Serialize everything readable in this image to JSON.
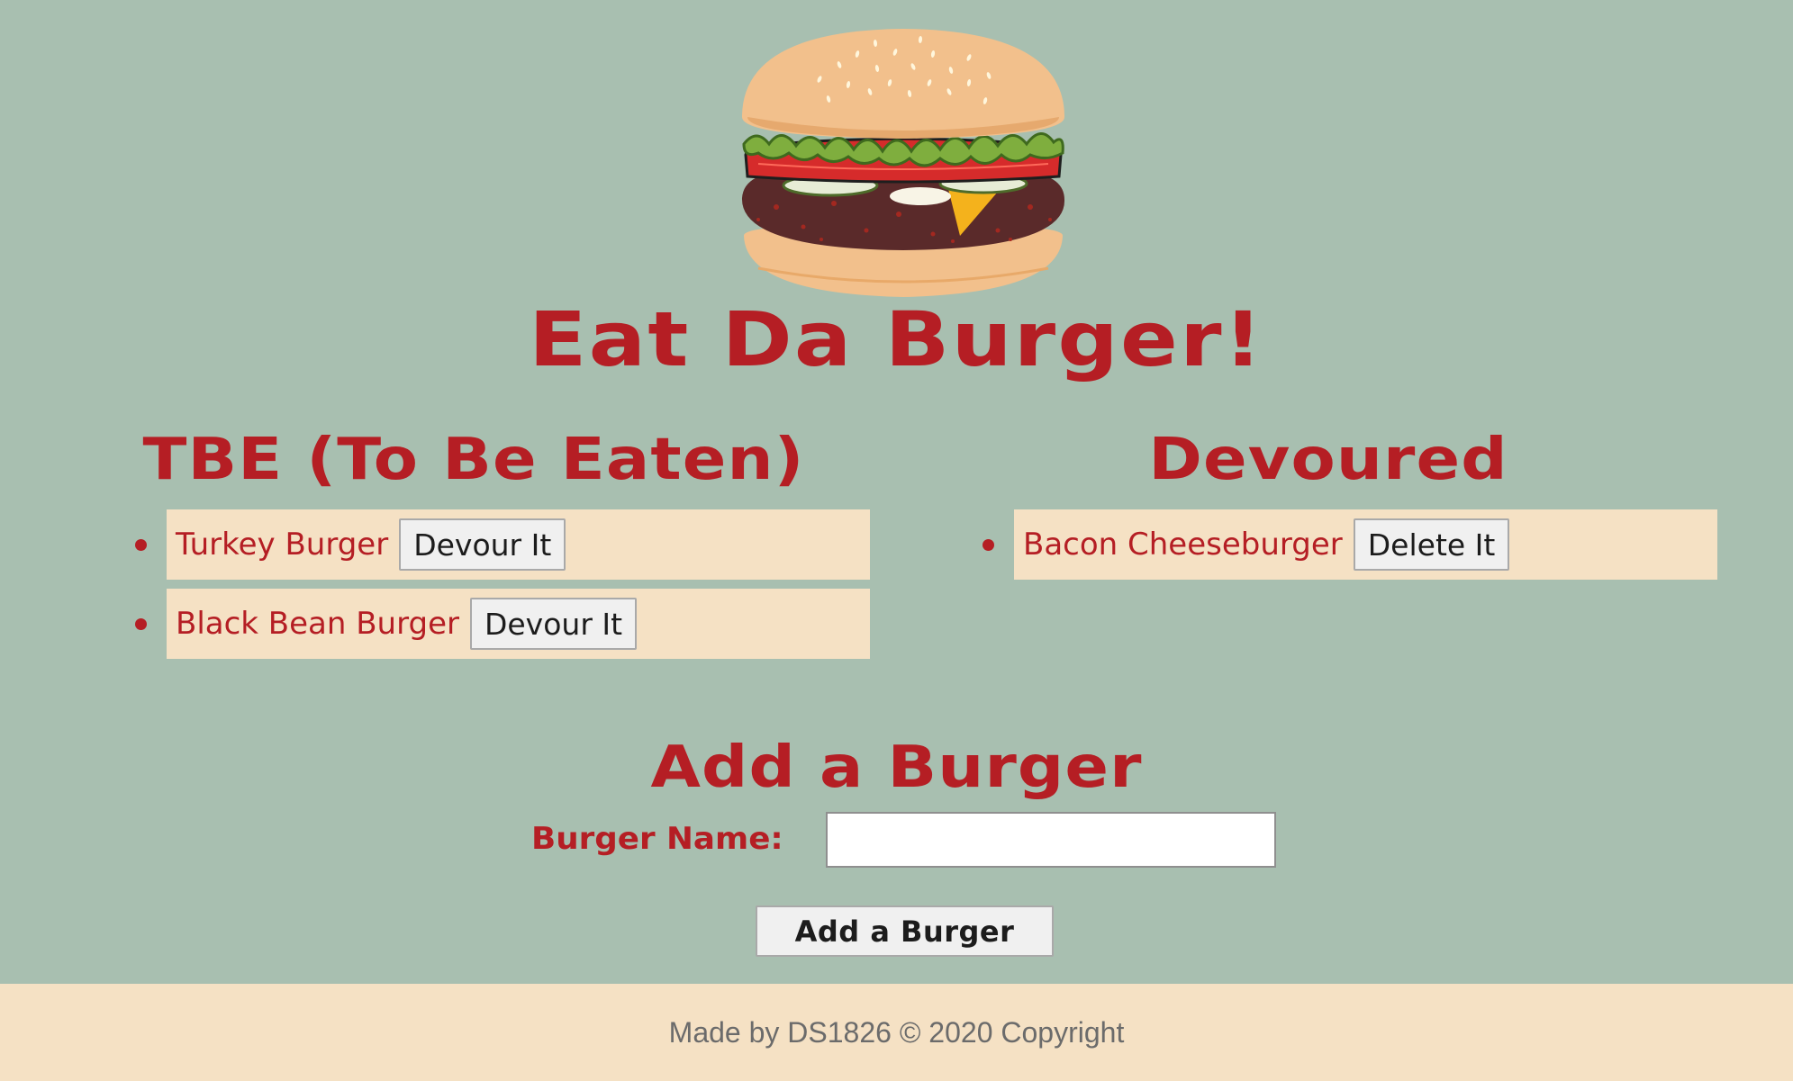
{
  "app": {
    "title": "Eat Da Burger!"
  },
  "logo": {
    "icon": "burger-icon"
  },
  "tbe": {
    "title": "TBE (To Be Eaten)",
    "items": [
      {
        "name": "Turkey Burger",
        "button_label": "Devour It"
      },
      {
        "name": "Black Bean Burger",
        "button_label": "Devour It"
      }
    ]
  },
  "devoured": {
    "title": "Devoured",
    "items": [
      {
        "name": "Bacon Cheeseburger",
        "button_label": "Delete It"
      }
    ]
  },
  "add_form": {
    "title": "Add a Burger",
    "name_label": "Burger Name:",
    "name_value": "",
    "name_placeholder": "",
    "submit_label": "Add a Burger"
  },
  "footer": {
    "text": "Made by DS1826 © 2020 Copyright"
  },
  "colors": {
    "background": "#a8bfb0",
    "accent": "#b51e24",
    "panel": "#f5e1c4",
    "footer_text": "#6b6b6b"
  }
}
